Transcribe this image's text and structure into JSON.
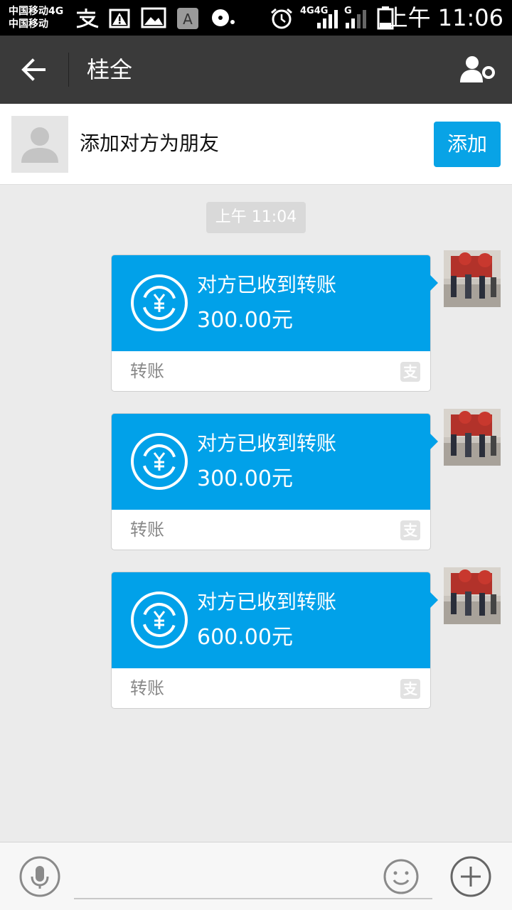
{
  "status_bar": {
    "carrier_1": "中国移动4G",
    "carrier_2": "中国移动",
    "network_1": "4G",
    "network_2": "4G",
    "network_3": "G",
    "time": "上午 11:06"
  },
  "nav": {
    "title": "桂全",
    "icons": {
      "back": "arrow-left-icon",
      "profile": "person-settings-icon"
    }
  },
  "add_friend": {
    "text": "添加对方为朋友",
    "button": "添加"
  },
  "timestamp": "上午 11:04",
  "messages": [
    {
      "title": "对方已收到转账",
      "amount": "300.00元",
      "label": "转账",
      "badge": "支"
    },
    {
      "title": "对方已收到转账",
      "amount": "300.00元",
      "label": "转账",
      "badge": "支"
    },
    {
      "title": "对方已收到转账",
      "amount": "600.00元",
      "label": "转账",
      "badge": "支"
    }
  ],
  "input_bar": {
    "placeholder": "",
    "icons": {
      "voice": "microphone-icon",
      "emoji": "smiley-icon",
      "more": "plus-icon"
    }
  },
  "colors": {
    "accent": "#01a1e9",
    "nav_bg": "#3a3a3a",
    "chat_bg": "#ebebeb"
  }
}
